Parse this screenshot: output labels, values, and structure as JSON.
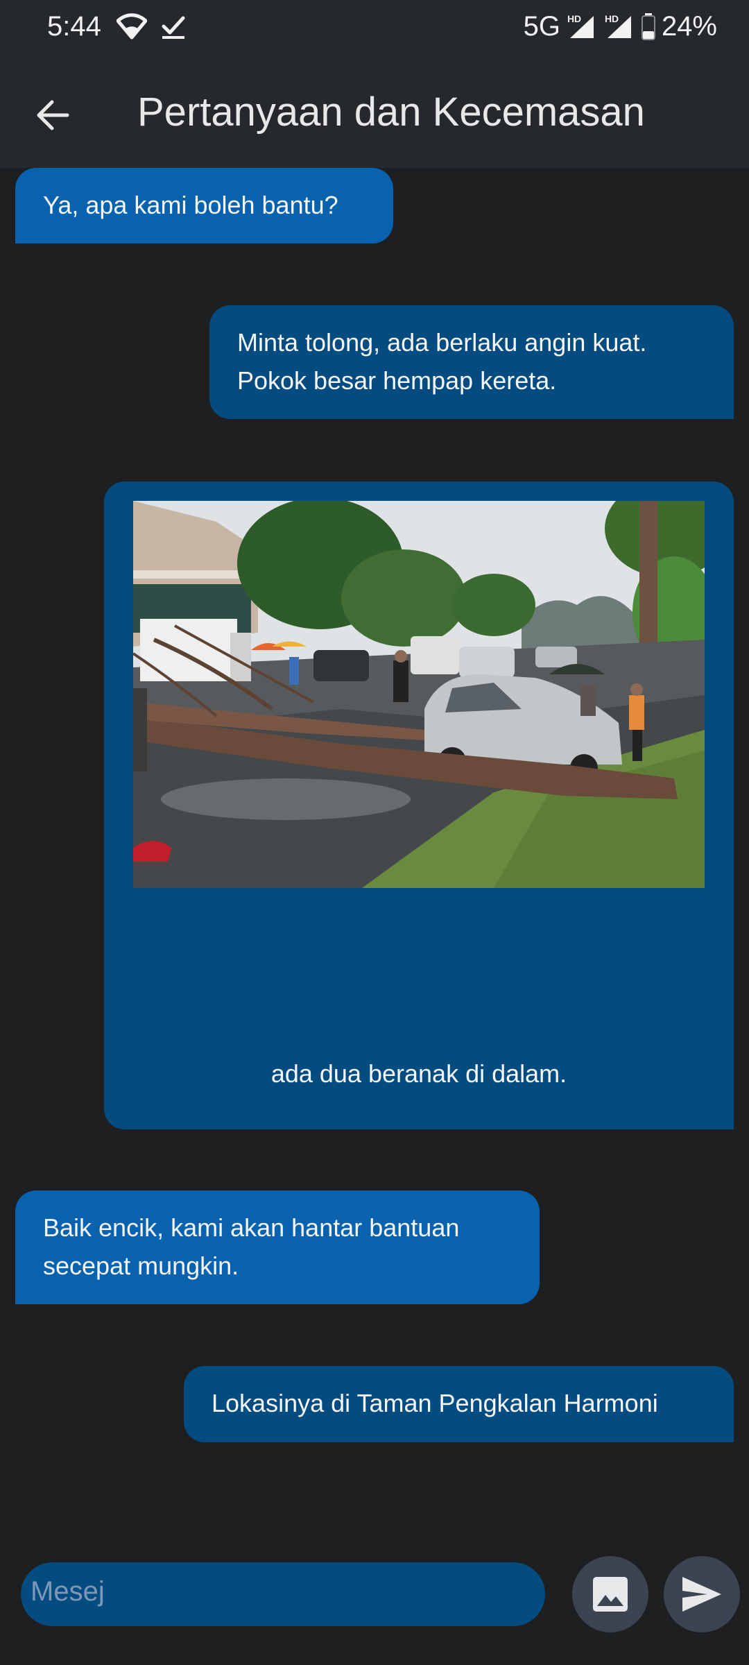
{
  "status_bar": {
    "time": "5:44",
    "network": "5G",
    "hd1": "HD",
    "hd2": "HD",
    "battery": "24%"
  },
  "app_bar": {
    "title": "Pertanyaan dan Kecemasan"
  },
  "messages": [
    {
      "direction": "incoming",
      "text": "Ya, apa kami boleh bantu?"
    },
    {
      "direction": "outgoing",
      "text_lines": [
        "Minta tolong, ada berlaku angin kuat.",
        "Pokok besar hempap kereta."
      ]
    },
    {
      "direction": "outgoing",
      "image": "fallen-tree-on-car-photo",
      "caption": "ada dua beranak di dalam."
    },
    {
      "direction": "incoming",
      "text_lines": [
        "Baik encik, kami akan hantar bantuan",
        "secepat mungkin."
      ]
    },
    {
      "direction": "outgoing",
      "text": "Lokasinya di Taman Pengkalan Harmoni"
    }
  ],
  "composer": {
    "placeholder": "Mesej",
    "image_icon": "image-icon",
    "send_icon": "send-icon"
  },
  "colors": {
    "background": "#1e1f21",
    "bar": "#25282c",
    "incoming_bubble": "#0862ad",
    "outgoing_bubble": "#044c80",
    "button": "#3b4450"
  }
}
